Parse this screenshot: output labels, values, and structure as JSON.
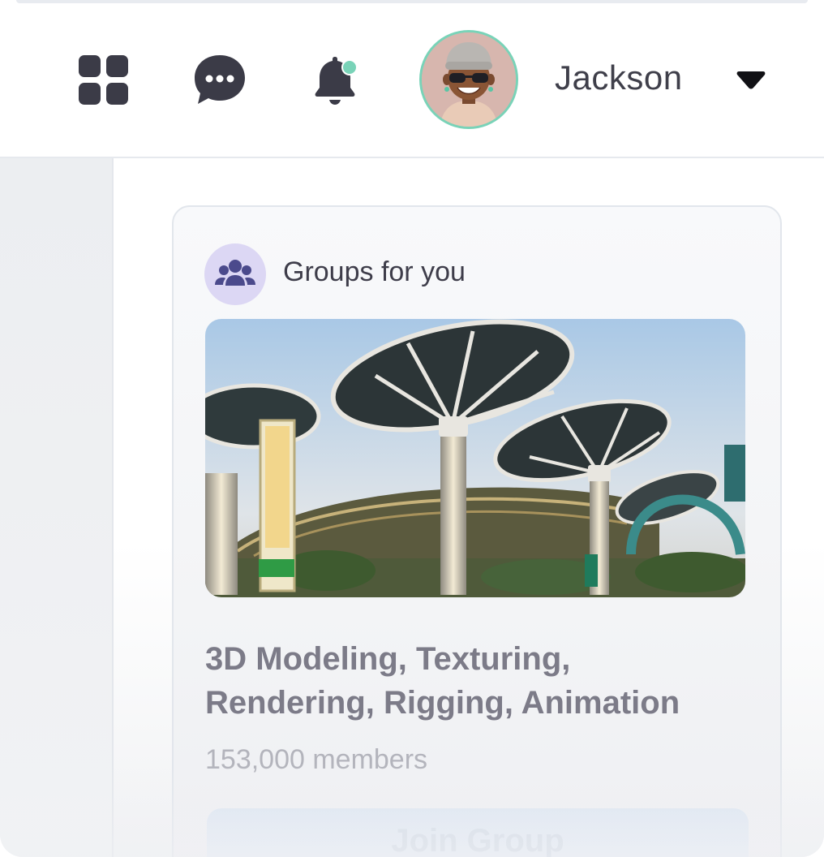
{
  "header": {
    "username": "Jackson",
    "icons": [
      "apps-grid-icon",
      "chat-bubble-icon",
      "bell-icon",
      "dropdown-arrow-icon"
    ],
    "notification_dot_color": "#79d3b8"
  },
  "card": {
    "heading": "Groups for you",
    "group_title": "3D Modeling, Texturing, Rendering, Rigging, Animation",
    "members": "153,000 members",
    "join_label": "Join Group"
  },
  "colors": {
    "accent_badge": "#dcd7f4",
    "badge_icon": "#4b4a8c",
    "icon_dark": "#3b3b47"
  }
}
